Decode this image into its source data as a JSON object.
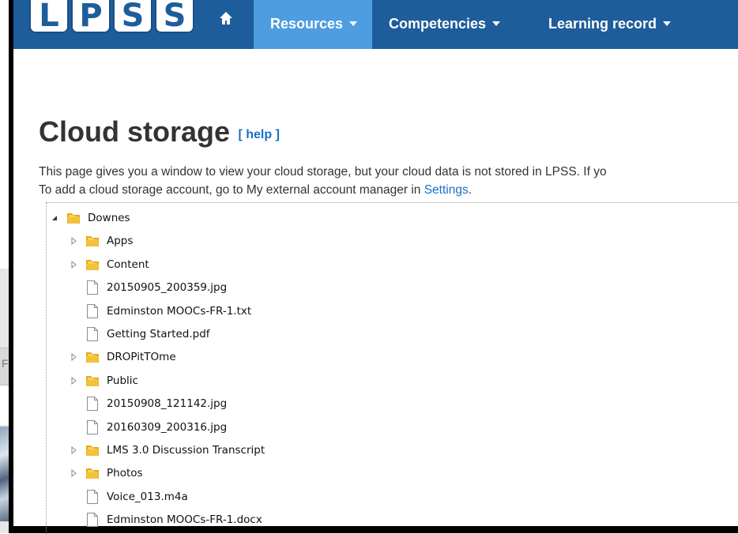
{
  "logo": {
    "letters": [
      "L",
      "P",
      "S",
      "S"
    ]
  },
  "nav": {
    "home_icon": "home-icon",
    "items": [
      {
        "label": "Resources",
        "active": true
      },
      {
        "label": "Competencies",
        "active": false
      },
      {
        "label": "Learning record",
        "active": false
      }
    ]
  },
  "page": {
    "title": "Cloud storage",
    "help_label": "[ help ]",
    "desc_line1": "This page gives you a window to view your cloud storage, but your cloud data is not stored in LPSS. If yo",
    "desc_line2_prefix": "To add a cloud storage account, go to My external account manager in ",
    "settings_link": "Settings",
    "desc_line2_suffix": "."
  },
  "tree": [
    {
      "label": "Downes",
      "type": "folder",
      "toggle": "expanded",
      "depth": 0
    },
    {
      "label": "Apps",
      "type": "folder",
      "toggle": "collapsed",
      "depth": 1
    },
    {
      "label": "Content",
      "type": "folder",
      "toggle": "collapsed",
      "depth": 1
    },
    {
      "label": "20150905_200359.jpg",
      "type": "file",
      "toggle": "none",
      "depth": 1
    },
    {
      "label": "Edminston MOOCs-FR-1.txt",
      "type": "file",
      "toggle": "none",
      "depth": 1
    },
    {
      "label": "Getting Started.pdf",
      "type": "file",
      "toggle": "none",
      "depth": 1
    },
    {
      "label": "DROPitTOme",
      "type": "folder",
      "toggle": "collapsed",
      "depth": 1
    },
    {
      "label": "Public",
      "type": "folder",
      "toggle": "collapsed",
      "depth": 1
    },
    {
      "label": "20150908_121142.jpg",
      "type": "file",
      "toggle": "none",
      "depth": 1
    },
    {
      "label": "20160309_200316.jpg",
      "type": "file",
      "toggle": "none",
      "depth": 1
    },
    {
      "label": "LMS 3.0 Discussion Transcript",
      "type": "folder",
      "toggle": "collapsed",
      "depth": 1
    },
    {
      "label": "Photos",
      "type": "folder",
      "toggle": "collapsed",
      "depth": 1
    },
    {
      "label": "Voice_013.m4a",
      "type": "file",
      "toggle": "none",
      "depth": 1
    },
    {
      "label": "Edminston MOOCs-FR-1.docx",
      "type": "file",
      "toggle": "none",
      "depth": 1
    }
  ],
  "background_fragment": {
    "letter": "F"
  }
}
